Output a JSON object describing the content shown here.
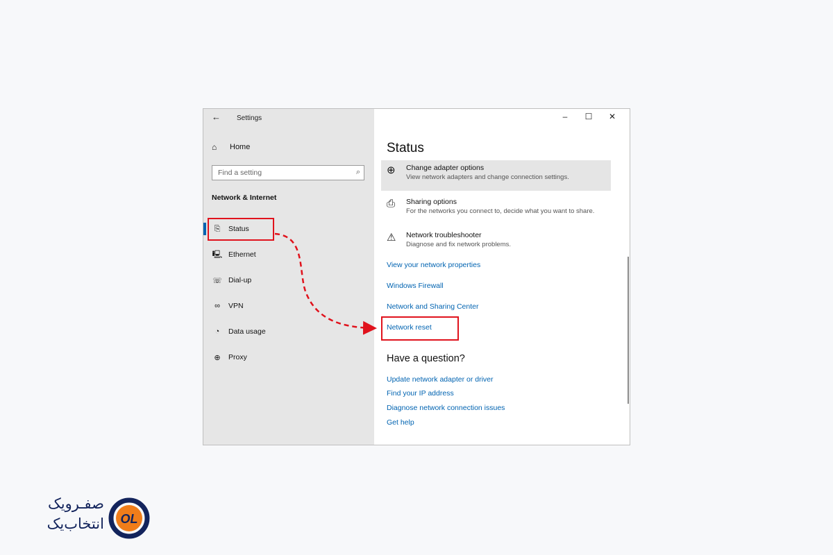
{
  "window": {
    "title": "Settings",
    "controls": {
      "minimize": "–",
      "maximize": "☐",
      "close": "✕"
    }
  },
  "sidebar": {
    "back_icon": "←",
    "home": {
      "icon": "⌂",
      "label": "Home"
    },
    "search": {
      "placeholder": "Find a setting",
      "icon": "⌕"
    },
    "section_heading": "Network & Internet",
    "items": [
      {
        "icon": "⎘",
        "label": "Status",
        "active": true
      },
      {
        "icon": "🖳",
        "label": "Ethernet"
      },
      {
        "icon": "☏",
        "label": "Dial-up"
      },
      {
        "icon": "∞",
        "label": "VPN"
      },
      {
        "icon": "◔",
        "label": "Data usage"
      },
      {
        "icon": "⊕",
        "label": "Proxy"
      }
    ]
  },
  "main": {
    "title": "Status",
    "settings": [
      {
        "icon": "⊕",
        "title": "Change adapter options",
        "desc": "View network adapters and change connection settings."
      },
      {
        "icon": "⎙",
        "title": "Sharing options",
        "desc": "For the networks you connect to, decide what you want to share."
      },
      {
        "icon": "⚠",
        "title": "Network troubleshooter",
        "desc": "Diagnose and fix network problems."
      }
    ],
    "links": [
      "View your network properties",
      "Windows Firewall",
      "Network and Sharing Center",
      "Network reset"
    ],
    "question_heading": "Have a question?",
    "question_links": [
      "Update network adapter or driver",
      "Find your IP address",
      "Diagnose network connection issues",
      "Get help"
    ]
  },
  "brand": {
    "line1": "صفـرویک",
    "line2": "انتخاب‌یک",
    "logo_text": "OL"
  },
  "colors": {
    "accent": "#0063b1",
    "highlight": "#e0121c",
    "brand": "#13245c",
    "brand_orange": "#f07d1a"
  }
}
